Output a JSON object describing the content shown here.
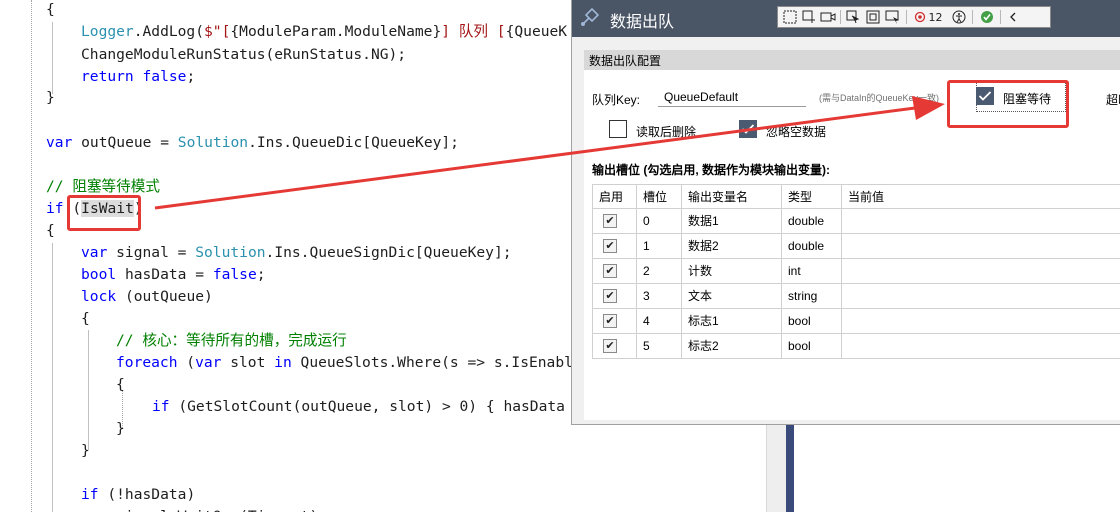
{
  "editor": {
    "lines": [
      {
        "id": "l1",
        "html": "{"
      },
      {
        "id": "l2",
        "html": "<span class=\"ty\">Logger</span>.AddLog(<span class=\"st\">$\"[</span>{ModuleParam.ModuleName}<span class=\"st\">] 队列 [</span>{QueueK"
      },
      {
        "id": "l3",
        "html": "ChangeModuleRunStatus(eRunStatus.NG);"
      },
      {
        "id": "l4",
        "html": "<span class=\"kw\">return</span> <span class=\"kw\">false</span>;"
      },
      {
        "id": "l5",
        "html": "}"
      },
      {
        "id": "l6",
        "html": "<span class=\"kw\">var</span> outQueue = <span class=\"ty\">Solution</span>.Ins.QueueDic[QueueKey];"
      },
      {
        "id": "l7",
        "html": "<span class=\"cm\">// 阻塞等待模式</span>"
      },
      {
        "id": "l8",
        "html": "<span class=\"kw\">if</span> (<span class=\"hl\">IsWait</span>)"
      },
      {
        "id": "l9",
        "html": "{"
      },
      {
        "id": "l10",
        "html": "<span class=\"kw\">var</span> signal = <span class=\"ty\">Solution</span>.Ins.QueueSignDic[QueueKey];"
      },
      {
        "id": "l11",
        "html": "<span class=\"kw\">bool</span> hasData = <span class=\"kw\">false</span>;"
      },
      {
        "id": "l12",
        "html": "<span class=\"kw\">lock</span> (outQueue)"
      },
      {
        "id": "l13",
        "html": "{"
      },
      {
        "id": "l14",
        "html": "<span class=\"cm\">// 核心：等待所有的槽，完成运行</span>"
      },
      {
        "id": "l15",
        "html": "<span class=\"kw\">foreach</span> (<span class=\"kw\">var</span> slot <span class=\"kw\">in</span> QueueSlots.Where(s =&gt; s.IsEnabl"
      },
      {
        "id": "l16",
        "html": "{"
      },
      {
        "id": "l17",
        "html": "<span class=\"kw\">if</span> (GetSlotCount(outQueue, slot) &gt; 0) { hasData"
      },
      {
        "id": "l18",
        "html": "}"
      },
      {
        "id": "l19",
        "html": "}"
      },
      {
        "id": "l20",
        "html": "<span class=\"kw\">if</span> (!hasData)"
      },
      {
        "id": "l21",
        "html": "    signal.WaitOne(Timeout);"
      }
    ]
  },
  "dialog": {
    "title": "数据出队",
    "toolbar": {
      "badge_count": "12"
    },
    "group_title": "数据出队配置",
    "queue_key_label": "队列Key:",
    "queue_key_value": "QueueDefault",
    "queue_key_hint": "(需与DataIn的QueueKey一致)",
    "blocking_label": "阻塞等待",
    "blocking_checked": true,
    "timeout_label": "超时",
    "delete_after_read_label": "读取后删除",
    "delete_after_read_checked": false,
    "ignore_empty_label": "忽略空数据",
    "ignore_empty_checked": true,
    "slots_label": "输出槽位 (勾选启用, 数据作为模块输出变量):",
    "grid": {
      "columns": [
        "启用",
        "槽位",
        "输出变量名",
        "类型",
        "当前值"
      ],
      "rows": [
        {
          "enabled": true,
          "slot": "0",
          "name": "数据1",
          "type": "double",
          "value": ""
        },
        {
          "enabled": true,
          "slot": "1",
          "name": "数据2",
          "type": "double",
          "value": ""
        },
        {
          "enabled": true,
          "slot": "2",
          "name": "计数",
          "type": "int",
          "value": ""
        },
        {
          "enabled": true,
          "slot": "3",
          "name": "文本",
          "type": "string",
          "value": ""
        },
        {
          "enabled": true,
          "slot": "4",
          "name": "标志1",
          "type": "bool",
          "value": ""
        },
        {
          "enabled": true,
          "slot": "5",
          "name": "标志2",
          "type": "bool",
          "value": ""
        }
      ]
    }
  },
  "colors": {
    "titlebar": "#4a5566",
    "annotation": "#e53935",
    "keyword": "#0000ff",
    "type": "#2b91af",
    "string": "#a31515",
    "comment": "#008000"
  }
}
